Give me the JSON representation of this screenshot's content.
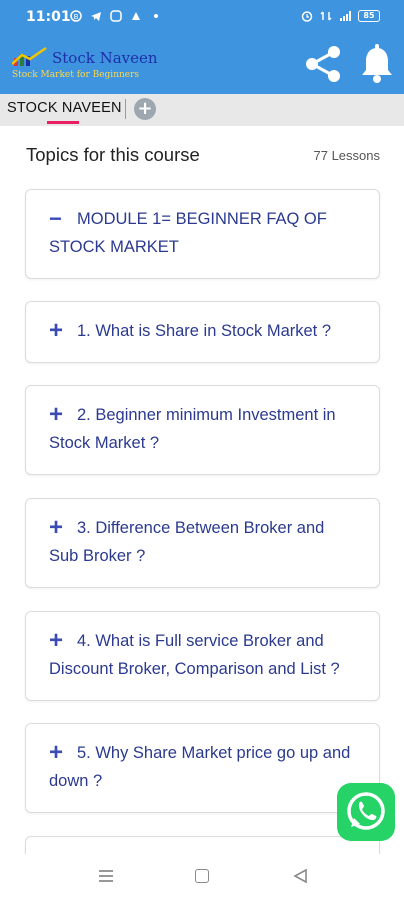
{
  "status_bar": {
    "time": "11:01",
    "battery": "85"
  },
  "app_bar": {
    "logo_title": "Stock Naveen",
    "logo_subtitle": "Stock Market for Beginners"
  },
  "tabs": {
    "active_label": "STOCK NAVEEN",
    "add_label": "+"
  },
  "course": {
    "topics_title": "Topics for this course",
    "lessons_count": "77 Lessons",
    "modules": [
      {
        "sign": "−",
        "title": "MODULE 1= BEGINNER FAQ OF STOCK MARKET"
      },
      {
        "sign": "+",
        "title": "1. What is Share in Stock Market ?"
      },
      {
        "sign": "+",
        "title": "2. Beginner minimum Investment in Stock Market ?"
      },
      {
        "sign": "+",
        "title": "3. Difference Between Broker and Sub Broker ?"
      },
      {
        "sign": "+",
        "title": "4. What is Full service Broker and Discount Broker, Comparison and List ?"
      },
      {
        "sign": "+",
        "title": "5. Why Share Market price go up and down ?"
      }
    ]
  },
  "colors": {
    "app_bar": "#3f94e0",
    "accent": "#e91e63",
    "link_text": "#2b3a8f",
    "whatsapp": "#25d366"
  }
}
